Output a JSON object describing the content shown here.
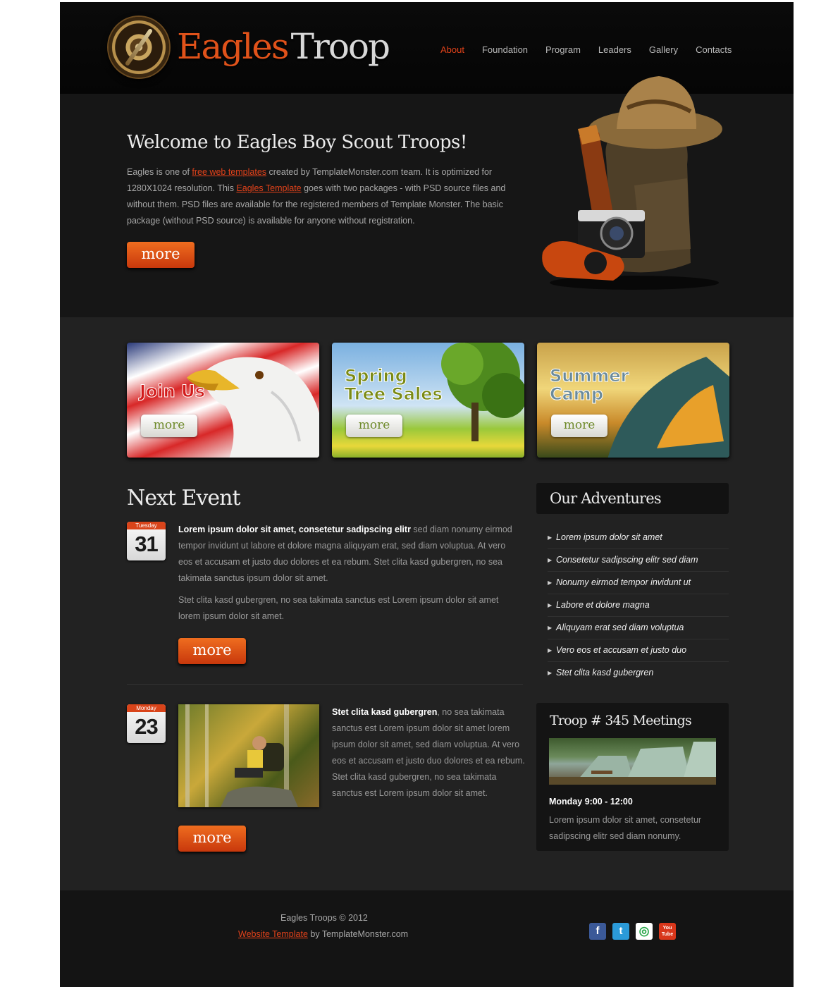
{
  "brand": {
    "word1": "Eagles",
    "word2": "Troop"
  },
  "nav": {
    "items": [
      "About",
      "Foundation",
      "Program",
      "Leaders",
      "Gallery",
      "Contacts"
    ],
    "active": "About"
  },
  "hero": {
    "title": "Welcome to Eagles Boy Scout Troops!",
    "text_1": "Eagles is one of ",
    "link_1": "free web templates",
    "text_2": " created by TemplateMonster.com team. It is optimized for 1280X1024 resolution. This ",
    "link_2": "Eagles Template",
    "text_3": " goes with two packages - with PSD source files and without them. PSD files are available for the registered members of Template Monster. The basic package (without PSD source) is available for anyone without registration.",
    "more": "more"
  },
  "features": [
    {
      "title_1": "Join Us",
      "title_2": "",
      "more": "more"
    },
    {
      "title_1": "Spring",
      "title_2": "Tree Sales",
      "more": "more"
    },
    {
      "title_1": "Summer",
      "title_2": "Camp",
      "more": "more"
    }
  ],
  "events": {
    "title": "Next Event",
    "items": [
      {
        "weekday": "Tuesday",
        "day": "31",
        "lead": "Lorem ipsum dolor sit amet, consetetur sadipscing elitr",
        "body": " sed diam nonumy eirmod tempor invidunt ut labore et dolore magna aliquyam erat, sed diam voluptua. At vero eos et accusam et justo duo dolores et ea rebum. Stet clita kasd gubergren, no sea takimata sanctus ipsum dolor sit amet.",
        "body_2": "Stet clita kasd gubergren, no sea takimata sanctus est Lorem ipsum dolor sit amet lorem ipsum dolor sit amet.",
        "more": "more"
      },
      {
        "weekday": "Monday",
        "day": "23",
        "lead": "Stet clita kasd gubergren",
        "body": ", no sea takimata sanctus est Lorem ipsum dolor sit amet lorem ipsum dolor sit amet, sed diam voluptua. At vero eos et accusam et justo duo dolores et ea rebum. Stet clita kasd gubergren, no sea takimata sanctus est Lorem ipsum dolor sit amet.",
        "more": "more"
      }
    ]
  },
  "adventures": {
    "title": "Our Adventures",
    "items": [
      "Lorem ipsum dolor sit amet",
      "Consetetur sadipscing elitr sed diam",
      "Nonumy eirmod tempor invidunt ut",
      "Labore et dolore magna",
      "Aliquyam erat sed diam voluptua",
      "Vero eos et accusam et justo duo",
      "Stet clita kasd gubergren"
    ]
  },
  "meetings": {
    "title": "Troop # 345 Meetings",
    "time": "Monday 9:00 - 12:00",
    "text": "Lorem ipsum dolor sit amet, consetetur sadipscing elitr sed diam nonumy."
  },
  "footer": {
    "copyright": "Eagles Troops © 2012",
    "link": "Website Template",
    "by": " by TemplateMonster.com",
    "social": [
      {
        "icon": "facebook-icon",
        "glyph": "f",
        "color": "#3b5998"
      },
      {
        "icon": "twitter-icon",
        "glyph": "t",
        "color": "#2b9ad8"
      },
      {
        "icon": "picasa-icon",
        "glyph": "◎",
        "color": "#ffffff"
      },
      {
        "icon": "youtube-icon",
        "glyph": "You Tube",
        "color": "#d8361a"
      }
    ]
  },
  "colors": {
    "accent": "#e0421a",
    "background": "#222222",
    "header": "#0a0a0a"
  }
}
